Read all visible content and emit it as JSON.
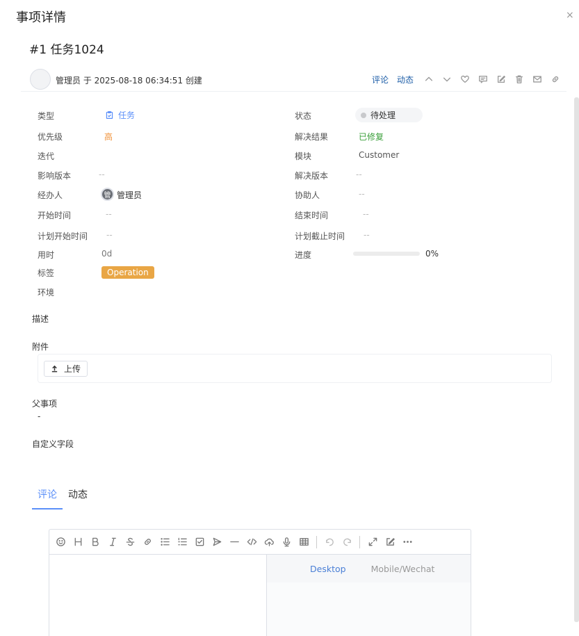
{
  "dialog": {
    "title": "事项详情",
    "close": "×"
  },
  "issue": {
    "title": "#1 任务1024"
  },
  "meta": {
    "creator_line": "管理员 于 2025-08-18 06:34:51 创建",
    "comment_link": "评论",
    "activity_link": "动态",
    "action_icons": [
      "chevron-up-icon",
      "chevron-down-icon",
      "heart-icon",
      "comment-icon",
      "edit-icon",
      "trash-icon",
      "mail-icon",
      "link-icon"
    ]
  },
  "fields": {
    "type": {
      "label": "类型",
      "value": "任务"
    },
    "status": {
      "label": "状态",
      "value": "待处理"
    },
    "priority": {
      "label": "优先级",
      "value": "高"
    },
    "resolution": {
      "label": "解决结果",
      "value": "已修复"
    },
    "iteration": {
      "label": "迭代",
      "value": ""
    },
    "module": {
      "label": "模块",
      "value": "Customer"
    },
    "affected_version": {
      "label": "影响版本",
      "value": "--"
    },
    "fixed_version": {
      "label": "解决版本",
      "value": "--"
    },
    "assignee": {
      "label": "经办人",
      "value": "管理员",
      "avatar_char": "管"
    },
    "collaborator": {
      "label": "协助人",
      "value": "--"
    },
    "start_time": {
      "label": "开始时间",
      "value": "--"
    },
    "end_time": {
      "label": "结束时间",
      "value": "--"
    },
    "planned_start": {
      "label": "计划开始时间",
      "value": "--"
    },
    "planned_deadline": {
      "label": "计划截止时间",
      "value": "--"
    },
    "time_spent": {
      "label": "用时",
      "value": "0d"
    },
    "progress": {
      "label": "进度",
      "value": "0%",
      "fraction": 0
    },
    "tags": {
      "label": "标签",
      "value": "Operation"
    },
    "environment": {
      "label": "环境",
      "value": ""
    }
  },
  "sections": {
    "description": "描述",
    "attachments": "附件",
    "upload_button": "上传",
    "parent_item": "父事项",
    "parent_value": "-",
    "custom_fields": "自定义字段"
  },
  "tabs": [
    {
      "label": "评论",
      "active": true
    },
    {
      "label": "动态",
      "active": false
    }
  ],
  "editor": {
    "toolbar_icons": [
      "emoji-icon",
      "heading-icon",
      "bold-icon",
      "italic-icon",
      "strike-icon",
      "link-icon",
      "bullet-list-icon",
      "ordered-list-icon",
      "checklist-icon",
      "send-icon",
      "hr-icon",
      "code-icon",
      "cloud-upload-icon",
      "mic-icon",
      "table-icon",
      "undo-icon",
      "redo-icon",
      "fullscreen-icon",
      "edit-mode-icon",
      "more-icon"
    ],
    "preview_tabs": [
      "Desktop",
      "Mobile/Wechat"
    ]
  },
  "colors": {
    "accent": "#5b8ff9",
    "priority_high": "#f0923a",
    "resolved": "#3a9f3a",
    "tag": "#e9a645"
  }
}
